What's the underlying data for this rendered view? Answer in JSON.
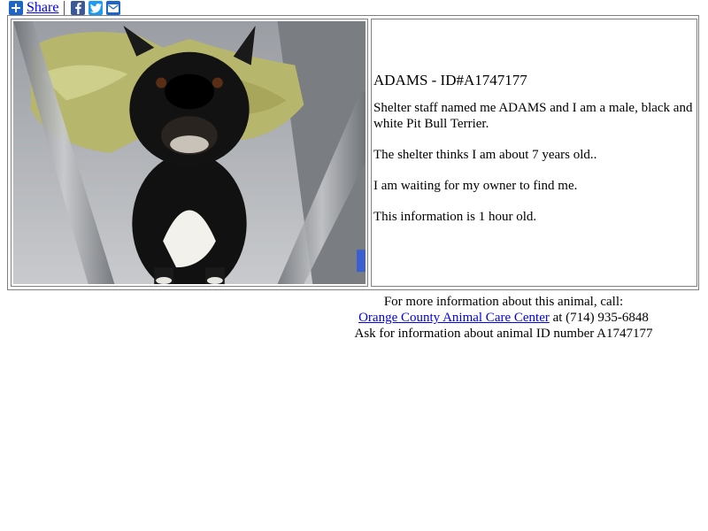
{
  "share": {
    "label": "Share",
    "icons": [
      "plus-icon",
      "facebook-icon",
      "twitter-icon",
      "email-icon"
    ]
  },
  "animal": {
    "title": "ADAMS - ID#A1747177",
    "description": "Shelter staff named me ADAMS and I am a male, black and white Pit Bull Terrier.",
    "age": "The shelter thinks I am about 7 years old..",
    "status": "I am waiting for my owner to find me.",
    "updated": "This information is 1 hour old.",
    "photo_icon": "dog-photo"
  },
  "footer": {
    "line1": "For more information about this animal, call:",
    "org_link": "Orange County Animal Care Center",
    "phone": "at (714) 935-6848",
    "line3": "Ask for information about animal ID number A1747177"
  },
  "colors": {
    "link": "#0000ee",
    "share_blue": "#1d66c7",
    "facebook": "#3b5998",
    "twitter": "#1d9bf0"
  }
}
